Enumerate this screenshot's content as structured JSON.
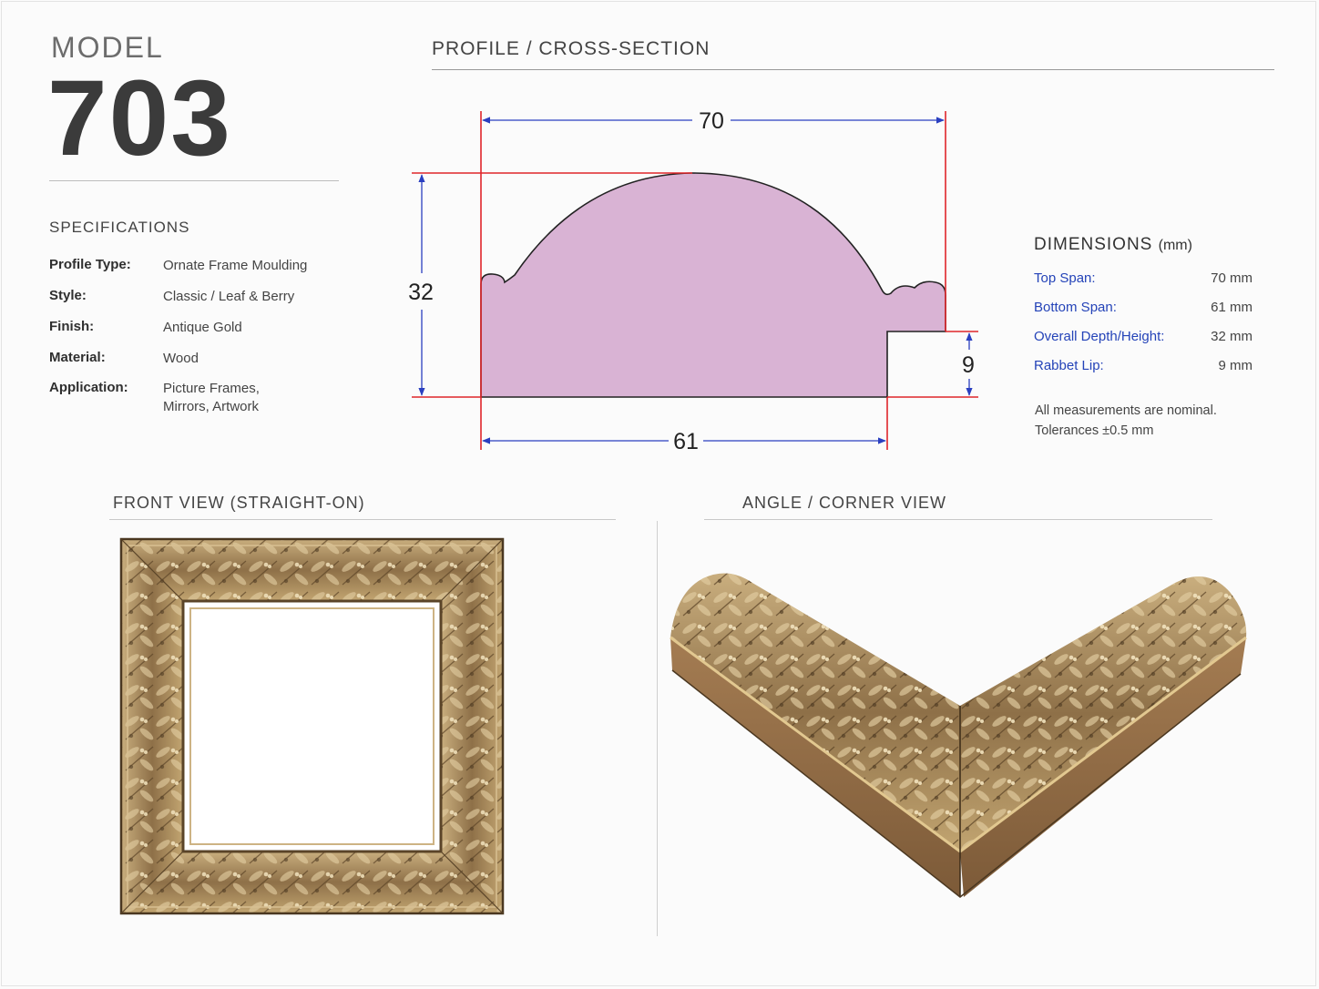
{
  "model": {
    "label": "MODEL",
    "number": "703"
  },
  "profile": {
    "title": "PROFILE / CROSS-SECTION",
    "dims": {
      "top": "70",
      "bottom": "61",
      "height": "32",
      "lip": "9"
    }
  },
  "specifications": {
    "title": "SPECIFICATIONS",
    "rows": [
      {
        "key": "Profile Type:",
        "value": "Ornate Frame Moulding"
      },
      {
        "key": "Style:",
        "value": "Classic / Leaf & Berry"
      },
      {
        "key": "Finish:",
        "value": "Antique Gold"
      },
      {
        "key": "Material:",
        "value": "Wood"
      },
      {
        "key": "Application:",
        "value": "Picture Frames,",
        "value2": "Mirrors, Artwork"
      }
    ]
  },
  "dimensions": {
    "title": "DIMENSIONS",
    "unit": "(mm)",
    "rows": [
      {
        "key": "Top Span:",
        "value": "70 mm"
      },
      {
        "key": "Bottom Span:",
        "value": "61 mm"
      },
      {
        "key": "Overall Depth/Height:",
        "value": "32 mm"
      },
      {
        "key": "Rabbet Lip:",
        "value": "9 mm"
      }
    ],
    "note_line1": "All measurements are nominal.",
    "note_line2": "Tolerances ±0.5 mm"
  },
  "views": {
    "front_title": "FRONT VIEW (STRAIGHT-ON)",
    "angle_title": "ANGLE / CORNER VIEW"
  },
  "colors": {
    "profile_fill": "#d9b3d4",
    "dim_red": "#e0262b",
    "dim_blue": "#2a3fc0",
    "gold_dark": "#6b5232",
    "gold_mid": "#a98a5c",
    "gold_light": "#d9c196"
  }
}
